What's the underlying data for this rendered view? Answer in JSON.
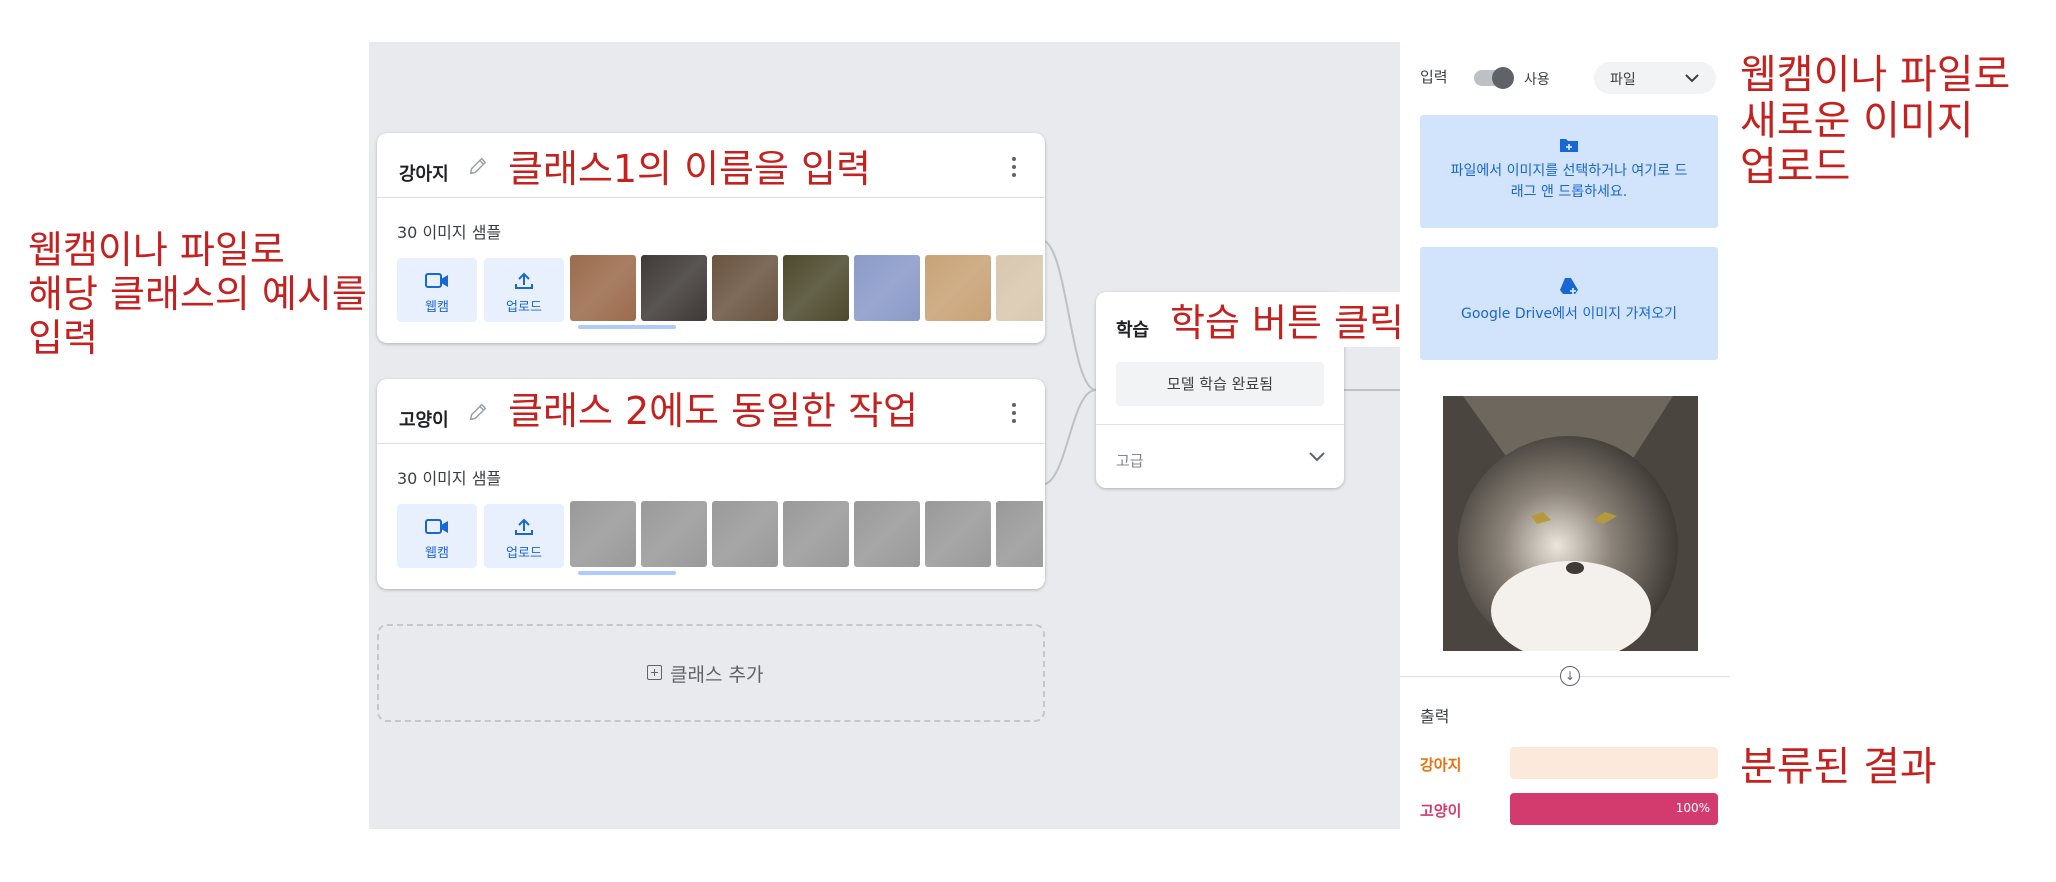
{
  "classes": [
    {
      "name": "강아지",
      "samples_label": "30 이미지 샘플",
      "webcam_label": "웹캠",
      "upload_label": "업로드",
      "thumb_colors": [
        "#9b6b4c",
        "#3f3a38",
        "#6a5440",
        "#4d4a2e",
        "#8a9ac8",
        "#c8a276",
        "#d9c7ae"
      ]
    },
    {
      "name": "고양이",
      "samples_label": "30 이미지 샘플",
      "webcam_label": "웹캠",
      "upload_label": "업로드",
      "thumb_colors": [
        "#8d8a88",
        "#5a3a30",
        "#b3a186",
        "#9a8b78",
        "#6d6e72",
        "#3e5a7a",
        "#707478"
      ]
    }
  ],
  "add_class_label": "클래스 추가",
  "training": {
    "title": "학습",
    "button_label": "모델 학습 완료됨",
    "advanced_label": "고급"
  },
  "preview": {
    "input_label": "입력",
    "toggle_label": "사용",
    "source_select": "파일",
    "file_drop_text": "파일에서 이미지를 선택하거나 여기로 드래그 앤 드롭하세요.",
    "drive_text": "Google Drive에서 이미지 가져오기",
    "output_label": "출력",
    "results": [
      {
        "label": "강아지",
        "percent": 0,
        "percent_text": "",
        "color": "#e8710a",
        "bg": "#fde9dc"
      },
      {
        "label": "고양이",
        "percent": 100,
        "percent_text": "100%",
        "color": "#d33b6e",
        "bg": "#fadbe6"
      }
    ]
  },
  "annotations": {
    "class1_name": "클래스1의 이름을 입력",
    "class2_same": "클래스 2에도 동일한 작업",
    "train_click": "학습 버튼 클릭",
    "left_note": [
      "웹캠이나 파일로",
      "해당 클래스의 예시를",
      "입력"
    ],
    "upload_note": [
      "웹캠이나 파일로",
      "새로운 이미지",
      "업로드"
    ],
    "result_note": "분류된 결과"
  },
  "colors": {
    "accent_blue": "#1967d2",
    "annotation_red": "#c5221f",
    "canvas_gray": "#e8eaed"
  }
}
